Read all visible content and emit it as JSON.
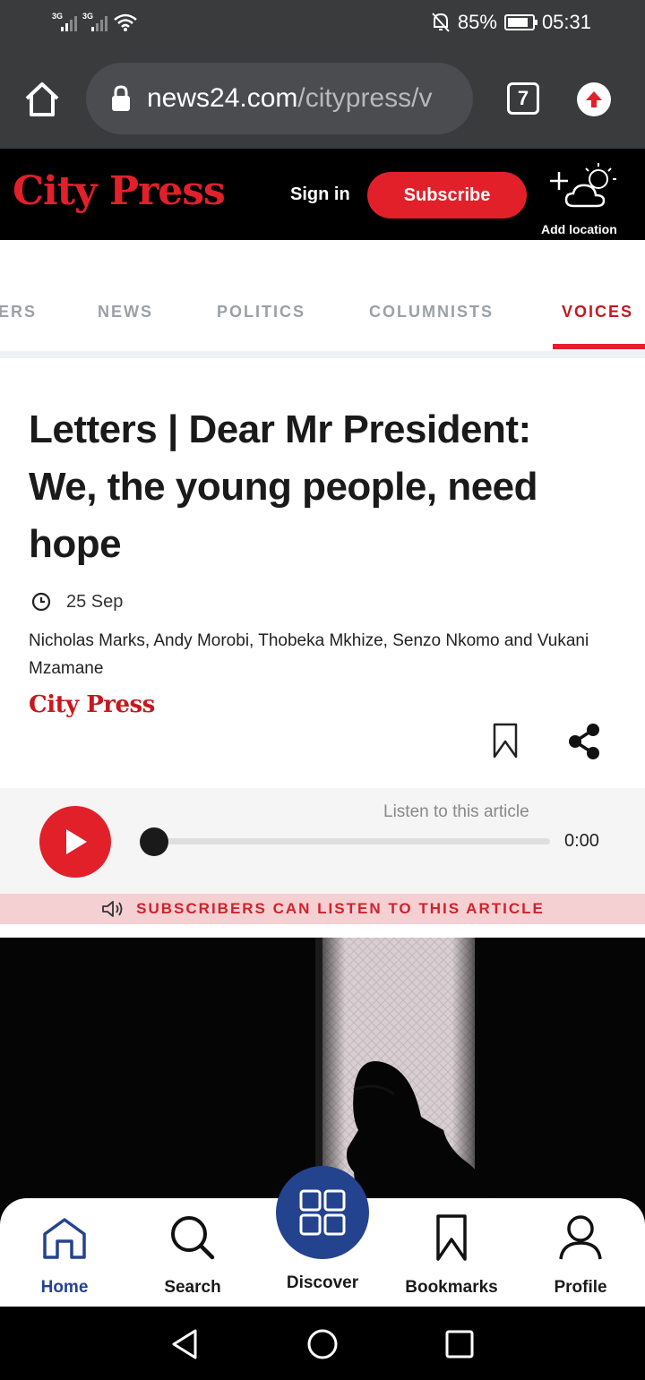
{
  "status_bar": {
    "signal_1": "3G",
    "signal_2": "3G",
    "battery": "85%",
    "time": "05:31",
    "icons": [
      "signal-icon",
      "signal-icon",
      "wifi-icon",
      "mute-icon",
      "battery-icon"
    ]
  },
  "browser": {
    "url_domain": "news24.com",
    "url_path": "/citypress/v",
    "tab_count": "7",
    "icons": [
      "home-icon",
      "lock-icon",
      "tabs-icon",
      "update-icon"
    ]
  },
  "header": {
    "logo": "City Press",
    "sign_in": "Sign in",
    "subscribe": "Subscribe",
    "add_location": "Add location"
  },
  "categories": [
    "ERS",
    "NEWS",
    "POLITICS",
    "COLUMNISTS",
    "VOICES"
  ],
  "active_category": "VOICES",
  "article": {
    "headline_line1": "Letters | Dear Mr President:",
    "headline_line2": "We, the young people, need",
    "headline_line3": "hope",
    "date": "25 Sep",
    "authors": "Nicholas Marks, Andy Morobi, Thobeka Mkhize, Senzo Nkomo and Vukani Mzamane",
    "source": "City Press"
  },
  "audio": {
    "listen_label": "Listen to this article",
    "time": "0:00",
    "progress": 0,
    "subscribers_notice": "SUBSCRIBERS CAN LISTEN TO THIS ARTICLE"
  },
  "bottom_nav": {
    "home": "Home",
    "search": "Search",
    "discover": "Discover",
    "bookmarks": "Bookmarks",
    "profile": "Profile"
  },
  "colors": {
    "brand_red": "#e1202a",
    "nav_blue": "#24438f",
    "chrome_gray": "#3a3b3d"
  }
}
